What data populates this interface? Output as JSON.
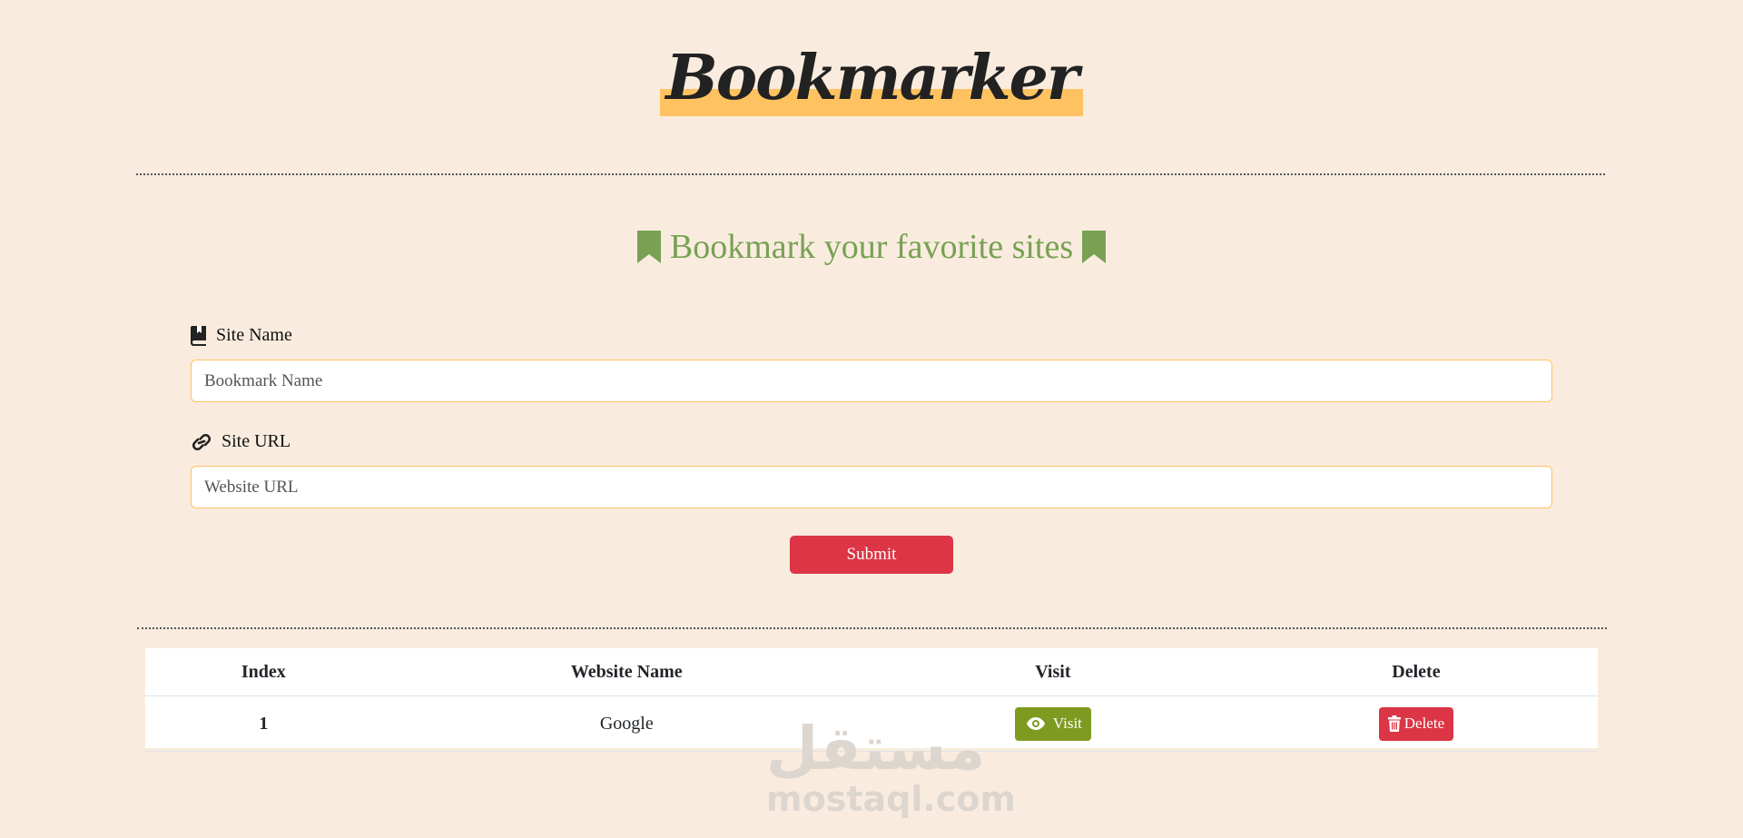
{
  "header": {
    "title": "Bookmarker",
    "highlight_color": "#fec260"
  },
  "subtitle": {
    "text": "Bookmark your favorite sites",
    "color": "#78a153",
    "icon": "bookmark-icon"
  },
  "form": {
    "site_name": {
      "label": "Site Name",
      "icon": "book-bookmark-icon",
      "placeholder": "Bookmark Name",
      "value": ""
    },
    "site_url": {
      "label": "Site URL",
      "icon": "link-icon",
      "placeholder": "Website URL",
      "value": ""
    },
    "submit_label": "Submit"
  },
  "table": {
    "headers": [
      "Index",
      "Website Name",
      "Visit",
      "Delete"
    ],
    "rows": [
      {
        "index": "1",
        "name": "Google",
        "visit_label": "Visit",
        "delete_label": "Delete"
      }
    ]
  },
  "colors": {
    "background": "#f9ecdf",
    "danger": "#dc3545",
    "visit": "#7f9a21",
    "input_border": "#fec260"
  },
  "watermark": {
    "arabic": "مستقل",
    "latin": "mostaql.com"
  }
}
